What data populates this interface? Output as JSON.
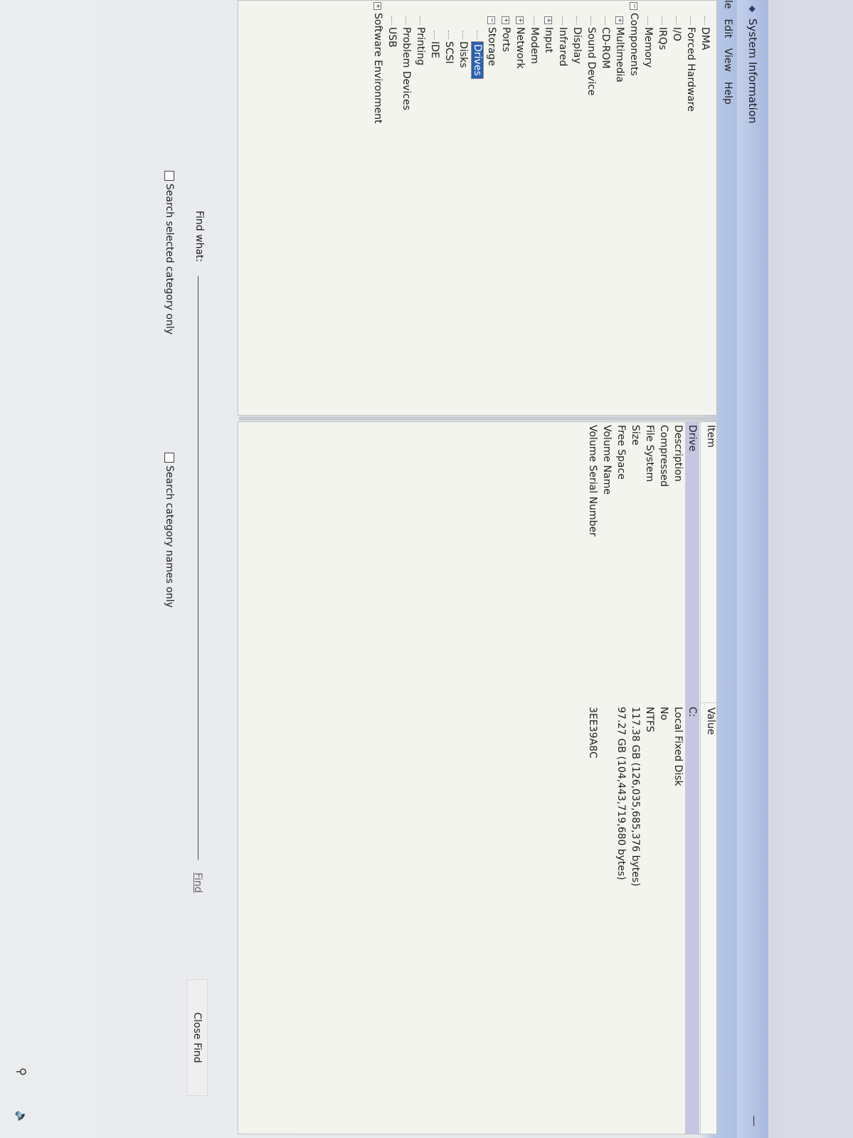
{
  "window": {
    "title": "System Information",
    "minimize_glyph": "—"
  },
  "menu": [
    "le",
    "Edit",
    "View",
    "Help"
  ],
  "tree": {
    "items": [
      {
        "label": "DMA",
        "indent": 1,
        "expander": ""
      },
      {
        "label": "Forced Hardware",
        "indent": 1,
        "expander": ""
      },
      {
        "label": "I/O",
        "indent": 1,
        "expander": ""
      },
      {
        "label": "IRQs",
        "indent": 1,
        "expander": ""
      },
      {
        "label": "Memory",
        "indent": 1,
        "expander": ""
      },
      {
        "label": "Components",
        "indent": 0,
        "expander": "−"
      },
      {
        "label": "Multimedia",
        "indent": 1,
        "expander": "+"
      },
      {
        "label": "CD-ROM",
        "indent": 1,
        "expander": ""
      },
      {
        "label": "Sound Device",
        "indent": 1,
        "expander": ""
      },
      {
        "label": "Display",
        "indent": 1,
        "expander": ""
      },
      {
        "label": "Infrared",
        "indent": 1,
        "expander": ""
      },
      {
        "label": "Input",
        "indent": 1,
        "expander": "+"
      },
      {
        "label": "Modem",
        "indent": 1,
        "expander": ""
      },
      {
        "label": "Network",
        "indent": 1,
        "expander": "+"
      },
      {
        "label": "Ports",
        "indent": 1,
        "expander": "+"
      },
      {
        "label": "Storage",
        "indent": 1,
        "expander": "−"
      },
      {
        "label": "Drives",
        "indent": 2,
        "expander": "",
        "selected": true
      },
      {
        "label": "Disks",
        "indent": 2,
        "expander": ""
      },
      {
        "label": "SCSI",
        "indent": 2,
        "expander": ""
      },
      {
        "label": "IDE",
        "indent": 2,
        "expander": ""
      },
      {
        "label": "Printing",
        "indent": 1,
        "expander": ""
      },
      {
        "label": "Problem Devices",
        "indent": 1,
        "expander": ""
      },
      {
        "label": "USB",
        "indent": 1,
        "expander": ""
      },
      {
        "label": "Software Environment",
        "indent": 0,
        "expander": "+"
      }
    ]
  },
  "details": {
    "col_item": "Item",
    "col_value": "Value",
    "rows": [
      {
        "item": "Drive",
        "value": "C:"
      },
      {
        "item": "Description",
        "value": "Local Fixed Disk"
      },
      {
        "item": "Compressed",
        "value": "No"
      },
      {
        "item": "File System",
        "value": "NTFS"
      },
      {
        "item": "Size",
        "value": "117.38 GB (126,035,685,376 bytes)"
      },
      {
        "item": "Free Space",
        "value": "97.27 GB (104,443,719,680 bytes)"
      },
      {
        "item": "Volume Name",
        "value": ""
      },
      {
        "item": "Volume Serial Number",
        "value": "3EE39A8C"
      }
    ]
  },
  "find": {
    "label": "Find what:",
    "value": "",
    "find_button": "Find",
    "close_button": "Close Find",
    "chk_selected": "Search selected category only",
    "chk_names": "Search category names only"
  },
  "bezel": {
    "logo": "hp"
  }
}
